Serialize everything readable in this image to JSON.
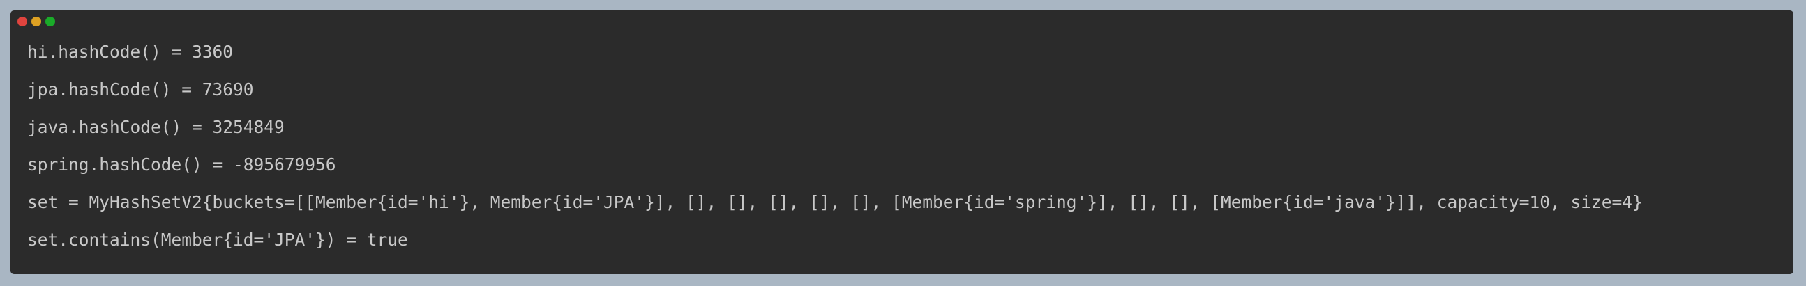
{
  "window": {
    "controls": [
      "close",
      "minimize",
      "maximize"
    ],
    "colors": {
      "background": "#2b2b2b",
      "text": "#c8c8c8",
      "close": "#e0443e",
      "minimize": "#dea123",
      "maximize": "#1aab29",
      "page_background": "#a9b6c3"
    }
  },
  "console": {
    "lines": [
      "hi.hashCode() = 3360",
      "jpa.hashCode() = 73690",
      "java.hashCode() = 3254849",
      "spring.hashCode() = -895679956",
      "set = MyHashSetV2{buckets=[[Member{id='hi'}, Member{id='JPA'}], [], [], [], [], [], [Member{id='spring'}], [], [], [Member{id='java'}]], capacity=10, size=4}",
      "set.contains(Member{id='JPA'}) = true"
    ]
  }
}
